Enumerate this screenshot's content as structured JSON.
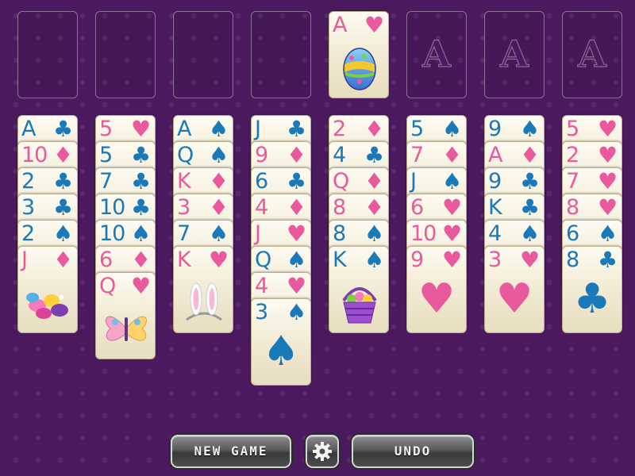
{
  "foundation": {
    "slots": [
      {
        "letter": ""
      },
      {
        "letter": ""
      },
      {
        "letter": ""
      },
      {
        "letter": ""
      },
      {
        "letter": ""
      },
      {
        "letter": "A"
      },
      {
        "letter": "A"
      },
      {
        "letter": "A"
      }
    ],
    "card": {
      "rank": "A",
      "suit": "♥",
      "color": "red",
      "picture": "easter-egg"
    }
  },
  "tableau": [
    [
      {
        "rank": "A",
        "suit": "♣",
        "color": "blue"
      },
      {
        "rank": "10",
        "suit": "♦",
        "color": "red"
      },
      {
        "rank": "2",
        "suit": "♣",
        "color": "blue"
      },
      {
        "rank": "3",
        "suit": "♣",
        "color": "blue"
      },
      {
        "rank": "2",
        "suit": "♠",
        "color": "blue"
      },
      {
        "rank": "J",
        "suit": "♦",
        "color": "red",
        "picture": "jelly-beans"
      }
    ],
    [
      {
        "rank": "5",
        "suit": "♥",
        "color": "red"
      },
      {
        "rank": "5",
        "suit": "♣",
        "color": "blue"
      },
      {
        "rank": "7",
        "suit": "♣",
        "color": "blue"
      },
      {
        "rank": "10",
        "suit": "♣",
        "color": "blue"
      },
      {
        "rank": "10",
        "suit": "♠",
        "color": "blue"
      },
      {
        "rank": "6",
        "suit": "♦",
        "color": "red"
      },
      {
        "rank": "Q",
        "suit": "♥",
        "color": "red",
        "picture": "butterfly"
      }
    ],
    [
      {
        "rank": "A",
        "suit": "♠",
        "color": "blue"
      },
      {
        "rank": "Q",
        "suit": "♠",
        "color": "blue"
      },
      {
        "rank": "K",
        "suit": "♦",
        "color": "red"
      },
      {
        "rank": "3",
        "suit": "♦",
        "color": "red"
      },
      {
        "rank": "7",
        "suit": "♠",
        "color": "blue"
      },
      {
        "rank": "K",
        "suit": "♥",
        "color": "red",
        "picture": "bunny-ears"
      }
    ],
    [
      {
        "rank": "J",
        "suit": "♣",
        "color": "blue"
      },
      {
        "rank": "9",
        "suit": "♦",
        "color": "red"
      },
      {
        "rank": "6",
        "suit": "♣",
        "color": "blue"
      },
      {
        "rank": "4",
        "suit": "♦",
        "color": "red"
      },
      {
        "rank": "J",
        "suit": "♥",
        "color": "red"
      },
      {
        "rank": "Q",
        "suit": "♠",
        "color": "blue"
      },
      {
        "rank": "4",
        "suit": "♥",
        "color": "red"
      },
      {
        "rank": "3",
        "suit": "♠",
        "color": "blue",
        "picture": "big-suit"
      }
    ],
    [
      {
        "rank": "2",
        "suit": "♦",
        "color": "red"
      },
      {
        "rank": "4",
        "suit": "♣",
        "color": "blue"
      },
      {
        "rank": "Q",
        "suit": "♦",
        "color": "red"
      },
      {
        "rank": "8",
        "suit": "♦",
        "color": "red"
      },
      {
        "rank": "8",
        "suit": "♠",
        "color": "blue"
      },
      {
        "rank": "K",
        "suit": "♠",
        "color": "blue",
        "picture": "easter-basket"
      }
    ],
    [
      {
        "rank": "5",
        "suit": "♠",
        "color": "blue"
      },
      {
        "rank": "7",
        "suit": "♦",
        "color": "red"
      },
      {
        "rank": "J",
        "suit": "♠",
        "color": "blue"
      },
      {
        "rank": "6",
        "suit": "♥",
        "color": "red"
      },
      {
        "rank": "10",
        "suit": "♥",
        "color": "red"
      },
      {
        "rank": "9",
        "suit": "♥",
        "color": "red",
        "picture": "big-suit"
      }
    ],
    [
      {
        "rank": "9",
        "suit": "♠",
        "color": "blue"
      },
      {
        "rank": "A",
        "suit": "♦",
        "color": "red"
      },
      {
        "rank": "9",
        "suit": "♣",
        "color": "blue"
      },
      {
        "rank": "K",
        "suit": "♣",
        "color": "blue"
      },
      {
        "rank": "4",
        "suit": "♠",
        "color": "blue"
      },
      {
        "rank": "3",
        "suit": "♥",
        "color": "red",
        "picture": "big-suit"
      }
    ],
    [
      {
        "rank": "5",
        "suit": "♥",
        "color": "red"
      },
      {
        "rank": "2",
        "suit": "♥",
        "color": "red"
      },
      {
        "rank": "7",
        "suit": "♥",
        "color": "red"
      },
      {
        "rank": "8",
        "suit": "♥",
        "color": "red"
      },
      {
        "rank": "6",
        "suit": "♠",
        "color": "blue"
      },
      {
        "rank": "8",
        "suit": "♣",
        "color": "blue",
        "picture": "big-suit"
      }
    ]
  ],
  "toolbar": {
    "new_game_label": "NEW GAME",
    "settings_icon": "gear-icon",
    "undo_label": "UNDO"
  },
  "colors": {
    "background": "#4b1a5e",
    "red_suit": "#e85a9c",
    "blue_suit": "#1a79b8"
  }
}
